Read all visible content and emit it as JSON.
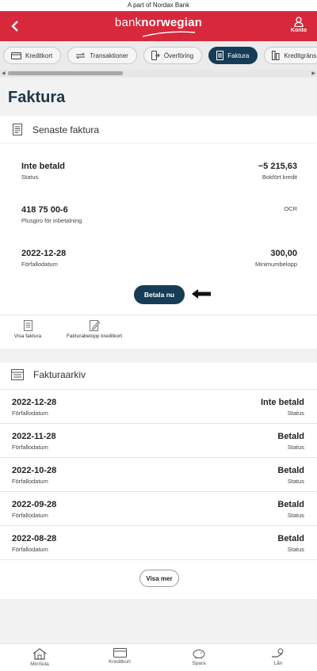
{
  "banner": {
    "text": "A part of Nordax Bank"
  },
  "header": {
    "logo_a": "bank",
    "logo_b": "norwegian",
    "account_label": "Konto"
  },
  "tabs": [
    {
      "label": "Kreditkort",
      "icon": "card-icon",
      "active": false
    },
    {
      "label": "Transaktioner",
      "icon": "transfer-icon",
      "active": false
    },
    {
      "label": "Överföring",
      "icon": "transfer-phone-icon",
      "active": false
    },
    {
      "label": "Faktura",
      "icon": "invoice-icon",
      "active": true
    },
    {
      "label": "Kreditgräns",
      "icon": "limit-icon",
      "active": false
    }
  ],
  "page": {
    "title": "Faktura"
  },
  "latest_invoice": {
    "heading": "Senaste faktura",
    "status_value": "Inte betald",
    "status_label": "Status",
    "amount_value": "−5 215,63",
    "amount_label": "Bokfört kredit",
    "pg_value": "418 75 00-6",
    "pg_label": "Plusgiro för inbetalning",
    "ocr_label": "OCR",
    "due_value": "2022-12-28",
    "due_label": "Förfallodatum",
    "min_value": "300,00",
    "min_label": "Minimumbelopp",
    "pay_button": "Betala nu",
    "action_view": "Visa faktura",
    "action_amount": "Fakturabelopp kreditkort"
  },
  "archive": {
    "heading": "Fakturaarkiv",
    "date_label": "Förfallodatum",
    "status_label": "Status",
    "rows": [
      {
        "date": "2022-12-28",
        "status": "Inte betald"
      },
      {
        "date": "2022-11-28",
        "status": "Betald"
      },
      {
        "date": "2022-10-28",
        "status": "Betald"
      },
      {
        "date": "2022-09-28",
        "status": "Betald"
      },
      {
        "date": "2022-08-28",
        "status": "Betald"
      }
    ],
    "more_button": "Visa mer"
  },
  "bottom_nav": [
    {
      "label": "MinSida",
      "icon": "home-icon"
    },
    {
      "label": "Kreditkort",
      "icon": "card-icon"
    },
    {
      "label": "Spara",
      "icon": "piggybank-icon"
    },
    {
      "label": "Lån",
      "icon": "loan-icon"
    }
  ],
  "colors": {
    "brand_red": "#d8283c",
    "navy": "#173c55"
  }
}
